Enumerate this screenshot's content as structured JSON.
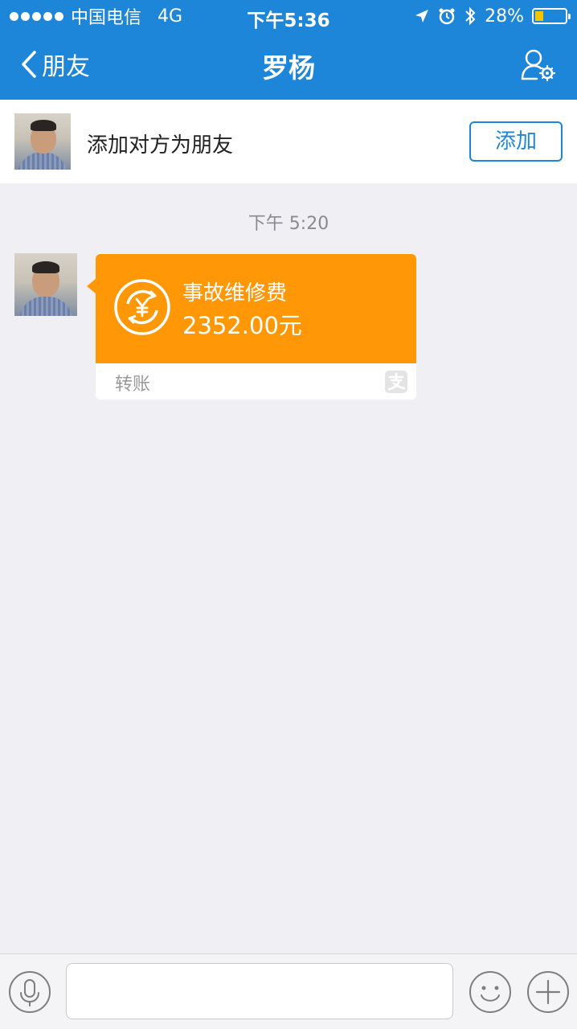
{
  "status_bar": {
    "carrier": "中国电信",
    "network": "4G",
    "time": "下午5:36",
    "battery_percent": "28%",
    "battery_level": 0.28
  },
  "nav": {
    "back_label": "朋友",
    "title": "罗杨",
    "settings_icon": "user-settings-icon"
  },
  "add_friend": {
    "prompt": "添加对方为朋友",
    "button_label": "添加"
  },
  "chat": {
    "timestamp": "下午 5:20",
    "message": {
      "type": "transfer",
      "title": "事故维修费",
      "amount": "2352.00元",
      "label": "转账",
      "accent_color": "#ff9706"
    }
  },
  "input_bar": {
    "voice_icon": "microphone-icon",
    "emoji_icon": "smiley-icon",
    "plus_icon": "plus-icon"
  },
  "colors": {
    "brand": "#1e86d8",
    "transfer": "#ff9706",
    "background": "#efeff4"
  }
}
